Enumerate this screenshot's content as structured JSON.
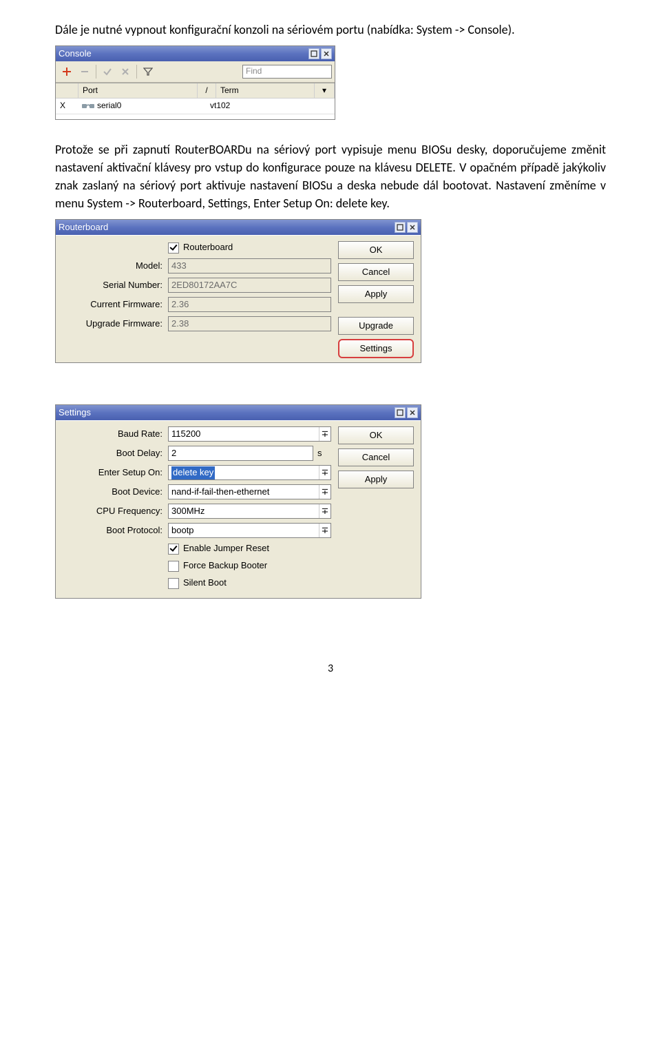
{
  "doc": {
    "para1": "Dále je nutné vypnout konfigurační konzoli na sériovém portu (nabídka: System -> Console).",
    "para2": "Protože se při zapnutí RouterBOARDu na sériový port vypisuje menu BIOSu desky, doporučujeme změnit nastavení aktivační klávesy pro vstup do konfigurace pouze na klávesu DELETE. V opačném případě jakýkoliv znak zaslaný na sériový port aktivuje nastavení BIOSu a deska nebude dál bootovat. Nastavení změníme v menu System -> Routerboard, Settings, Enter Setup On: delete key.",
    "page_num": "3"
  },
  "console_window": {
    "title": "Console",
    "toolbar_icons": [
      "plus-icon",
      "minus-icon",
      "check-icon",
      "x-icon",
      "funnel-icon"
    ],
    "find_placeholder": "Find",
    "columns": {
      "port": "Port",
      "divider": "/",
      "term": "Term",
      "dropdown": "▾"
    },
    "row": {
      "flag": "X",
      "port": "serial0",
      "term": "vt102"
    }
  },
  "rb_window": {
    "title": "Routerboard",
    "fields": [
      {
        "label": "",
        "checkbox": true,
        "checked": true,
        "text": "Routerboard"
      },
      {
        "label": "Model:",
        "value": "433"
      },
      {
        "label": "Serial Number:",
        "value": "2ED80172AA7C"
      },
      {
        "label": "Current Firmware:",
        "value": "2.36"
      },
      {
        "label": "Upgrade Firmware:",
        "value": "2.38"
      }
    ],
    "buttons": [
      "OK",
      "Cancel",
      "Apply",
      "Upgrade",
      "Settings"
    ]
  },
  "settings_window": {
    "title": "Settings",
    "buttons": [
      "OK",
      "Cancel",
      "Apply"
    ],
    "rows": [
      {
        "label": "Baud Rate:",
        "value": "115200",
        "select": true
      },
      {
        "label": "Boot Delay:",
        "value": "2",
        "unit": "s"
      },
      {
        "label": "Enter Setup On:",
        "value": "delete key",
        "select": true,
        "highlighted": true
      },
      {
        "label": "Boot Device:",
        "value": "nand-if-fail-then-ethernet",
        "select": true
      },
      {
        "label": "CPU Frequency:",
        "value": "300MHz",
        "select": true
      },
      {
        "label": "Boot Protocol:",
        "value": "bootp",
        "select": true
      }
    ],
    "checkboxes": [
      {
        "label": "Enable Jumper Reset",
        "checked": true
      },
      {
        "label": "Force Backup Booter",
        "checked": false
      },
      {
        "label": "Silent Boot",
        "checked": false
      }
    ]
  }
}
